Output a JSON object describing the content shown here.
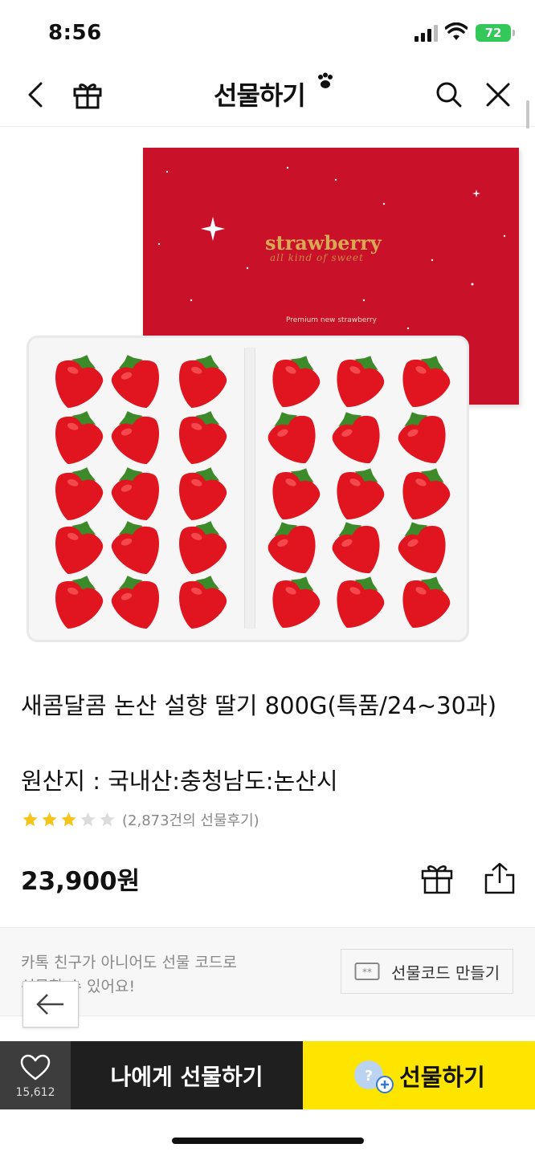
{
  "status_bar": {
    "time": "8:56",
    "battery": "72"
  },
  "header": {
    "title": "선물하기"
  },
  "product_image": {
    "brand": "strawberry",
    "brand_subtitle": "all kind of sweet",
    "premium_text": "Premium new strawberry"
  },
  "product": {
    "title": "새콤달콤 논산 설향 딸기 800G(특품/24~30과)",
    "origin": "원산지 : 국내산:충청남도:논산시",
    "rating": 3,
    "rating_max": 5,
    "review_count": "(2,873건의 선물후기)",
    "price": "23,900원"
  },
  "gift_code": {
    "desc_line1": "카톡 친구가 아니어도 선물 코드로",
    "desc_line2": "선물할 수 있어요!",
    "button_label": "선물코드 만들기"
  },
  "bottom_bar": {
    "like_count": "15,612",
    "self_gift_label": "나에게 선물하기",
    "gift_label": "선물하기"
  },
  "colors": {
    "accent_yellow": "#fee500",
    "box_red": "#c9112a",
    "star_gold": "#f5c518",
    "dark_bar": "#1f1f1f"
  },
  "icons": [
    "back-icon",
    "gift-icon",
    "paw-icon",
    "search-icon",
    "close-icon",
    "star-icon",
    "share-icon",
    "code-icon",
    "heart-icon",
    "friend-add-icon"
  ]
}
